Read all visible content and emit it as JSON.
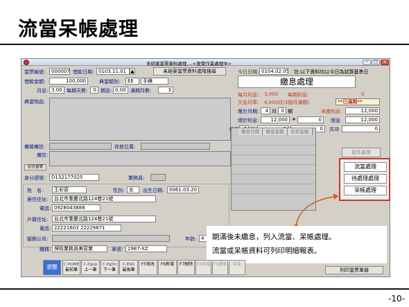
{
  "slide": {
    "title": "流當呆帳處理",
    "page_number": "-10-"
  },
  "window": {
    "title": "未結案當票資料處理....<查覽作業處理中>",
    "buttons": {
      "min": "─",
      "max": "□",
      "close": "✕"
    }
  },
  "left": {
    "ticket_no_label": "當票編號:",
    "ticket_no": "000007",
    "borrow_date_label": "借款日期:",
    "borrow_date": "0103.11.01",
    "search_btn": "未結案當票資料進階搜尋",
    "amount_label": "借款金額:",
    "amount": "100,000",
    "category_label": "典當類別:",
    "category_code": "EE",
    "category_name": "手錶",
    "rate_label": "月息:",
    "rate": "3.00",
    "days_label": "每期天數:",
    "days": "0",
    "periods_label": "期息:",
    "period_rate": "0.00",
    "months_label": "滿期月數:",
    "months": "3",
    "goods_label": "典當物品:",
    "goods_note_label": "備條備註:",
    "location_label": "存放位置:",
    "note_label": "備註:",
    "record_btn": "記住當號",
    "id_label": "身分證號:",
    "id_no": "D132177025",
    "agent_label": "業務員:",
    "name_label": "姓　名:",
    "name": "王彩容",
    "gender_label": "性別:",
    "gender": "女",
    "birth_label": "出生日期:",
    "birth": "0061.03.20",
    "home_addr_label": "居住住址:",
    "home_addr": "台北市重慶北路124巷21號",
    "phone_label": "電話:",
    "phone": "0928043888",
    "reg_addr_label": "戶籍住址:",
    "reg_addr": "台北市重慶北路124巷21號",
    "phone2_label": "電話:",
    "phone2": "22221603 22229871",
    "company_label": "服務公司:",
    "age_label": "年齡:",
    "age": "4",
    "job_label": "職務:",
    "job": "保險業務員美容業",
    "car_label": "車號:",
    "car": "2987-XZ"
  },
  "right": {
    "today_label": "今日日期:",
    "today": "0104.02.05",
    "today_note": "註:以下資料均以今日為試算基準日",
    "section_title": "繳息處理",
    "interest_label": "每月利息:",
    "interest": "3,000",
    "period_interest_label": "每期利息:",
    "period_interest": "0",
    "overdue_label": "欠息月率:",
    "overdue": "4,000月(3個月滿期)",
    "overdue_badge": "**已滿期**",
    "calc_label": "應計月期:",
    "calc_months": "4",
    "month_unit": "月",
    "calc_period": "0",
    "period_unit": "期",
    "unpaid_label": "未繳利息:",
    "unpaid": "12,000",
    "total_label": "總計利息:",
    "total": "12,000",
    "plus": "+",
    "zero": "0",
    "grand_label": "總息",
    "grand": "12,000",
    "pay_label": "繳息",
    "pay": "0",
    "times_unit": "次",
    "pay2": "0",
    "pay3": "0",
    "count_label": "共冲",
    "count": "0",
    "grid_headers": [
      "繳息日期",
      "繳息金額",
      "折扣金額"
    ],
    "cancel_btn": "取件處理",
    "forfeit_btn": "流當處理",
    "pending_btn": "待處理處理",
    "baddebt_btn": "呆帳處理",
    "print_btn": "列印當票單據"
  },
  "toolbar": [
    {
      "key": "",
      "label": "瀏覽"
    },
    {
      "key": "C-HOME",
      "label": "最前筆"
    },
    {
      "key": "C-PgUp",
      "label": "上一筆"
    },
    {
      "key": "C-PgDn",
      "label": "下一筆"
    },
    {
      "key": "C-END",
      "label": "最後筆"
    },
    {
      "key": "",
      "label": "F5修改"
    },
    {
      "key": "",
      "label": "F6新增"
    },
    {
      "key": "",
      "label": "F7刪除"
    },
    {
      "key": "",
      "label": "F8存檔"
    },
    {
      "key": "",
      "label": "F9還原"
    },
    {
      "key": "",
      "label": "結束"
    }
  ],
  "callout": {
    "line1": "期滿後未繳息，列入流當、呆帳處理。",
    "line2": "流當或呆帳資料可列印明細報表。"
  },
  "colors": {
    "accent_red": "#c0392b",
    "label_blue": "#001a80",
    "arrow": "#d05a20"
  }
}
